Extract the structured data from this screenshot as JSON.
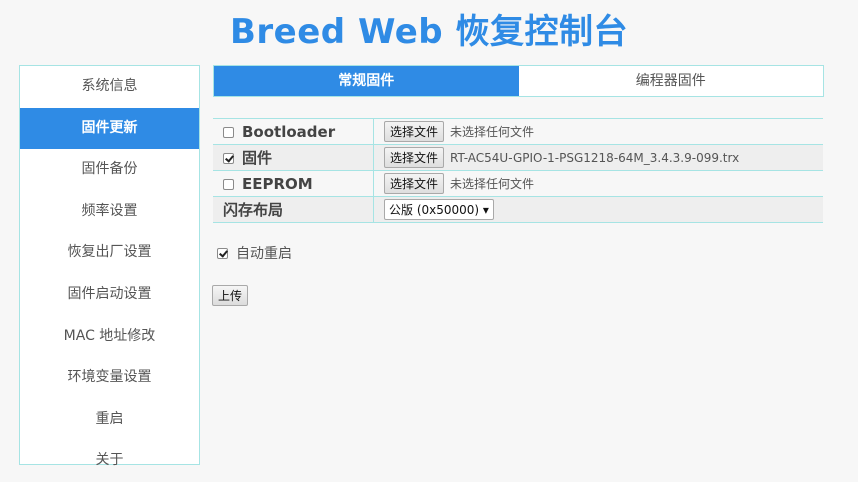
{
  "header": {
    "title": "Breed Web 恢复控制台"
  },
  "sidebar": {
    "items": [
      {
        "label": "系统信息"
      },
      {
        "label": "固件更新"
      },
      {
        "label": "固件备份"
      },
      {
        "label": "频率设置"
      },
      {
        "label": "恢复出厂设置"
      },
      {
        "label": "固件启动设置"
      },
      {
        "label": "MAC 地址修改"
      },
      {
        "label": "环境变量设置"
      },
      {
        "label": "重启"
      },
      {
        "label": "关于"
      }
    ]
  },
  "tabs": [
    {
      "label": "常规固件"
    },
    {
      "label": "编程器固件"
    }
  ],
  "form": {
    "rows": [
      {
        "label": "Bootloader",
        "checked": false,
        "button": "选择文件",
        "file": "未选择任何文件"
      },
      {
        "label": "固件",
        "checked": true,
        "button": "选择文件",
        "file": "RT-AC54U-GPIO-1-PSG1218-64M_3.4.3.9-099.trx"
      },
      {
        "label": "EEPROM",
        "checked": false,
        "button": "选择文件",
        "file": "未选择任何文件"
      }
    ],
    "layout": {
      "label": "闪存布局",
      "selected": "公版 (0x50000) ▾"
    }
  },
  "auto_reboot": {
    "label": "自动重启",
    "checked": true
  },
  "upload_button": "上传",
  "colors": {
    "accent": "#2f8be5",
    "border": "#a6e4e4"
  }
}
